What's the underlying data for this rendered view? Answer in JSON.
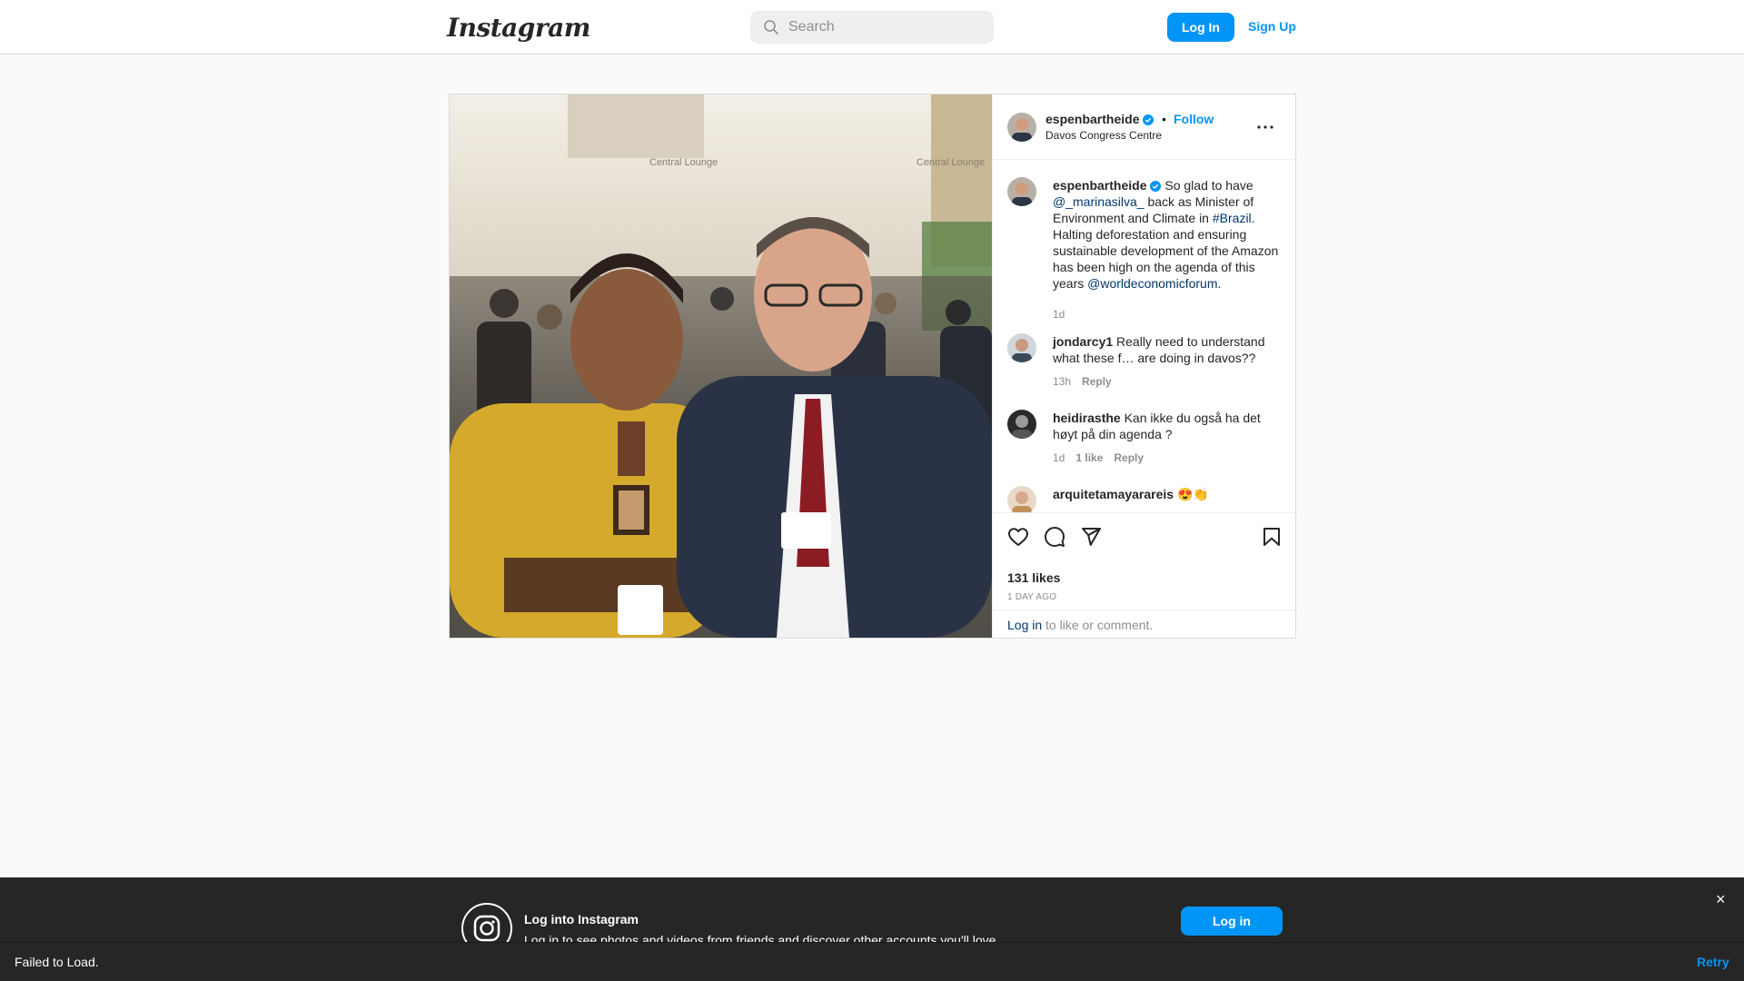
{
  "header": {
    "logo_text": "Instagram",
    "search_placeholder": "Search",
    "login_label": "Log In",
    "signup_label": "Sign Up"
  },
  "post": {
    "username": "espenbartheide",
    "separator": "•",
    "follow_label": "Follow",
    "location": "Davos Congress Centre",
    "caption": {
      "username": "espenbartheide",
      "text_1": " So glad to have ",
      "mention_1": "@_marinasilva_",
      "text_2": " back as Minister of Environment and Climate in ",
      "hashtag": "#Brazil",
      "text_3": ". Halting deforestation and ensuring sustainable development of the Amazon has been high on the agenda of this years ",
      "mention_2": "@worldeconomicforum",
      "text_4": ".",
      "time": "1d"
    },
    "comments": [
      {
        "username": "jondarcy1",
        "text": " Really need to understand what these f… are doing in davos??",
        "time": "13h",
        "likes": "",
        "reply": "Reply"
      },
      {
        "username": "heidirasthe",
        "text": " Kan ikke du også ha det høyt på din agenda ?",
        "time": "1d",
        "likes": "1 like",
        "reply": "Reply"
      },
      {
        "username": "arquitetamayarareis",
        "text": " 😍👏",
        "time": "",
        "likes": "",
        "reply": ""
      }
    ],
    "likes": "131 likes",
    "time_ago": "1 DAY AGO",
    "login_prompt_link": "Log in",
    "login_prompt_text": " to like or comment."
  },
  "banner": {
    "title": "Log into Instagram",
    "subtitle": "Log in to see photos and videos from friends and discover other accounts you'll love.",
    "login_label": "Log in",
    "close": "×"
  },
  "error_bar": {
    "message": "Failed to Load.",
    "retry_label": "Retry"
  },
  "colors": {
    "accent": "#0095f6",
    "link": "#00376b",
    "verified": "#0095f6"
  },
  "icons": [
    "search-icon",
    "verified-badge-icon",
    "more-options-icon",
    "heart-icon",
    "comment-icon",
    "share-icon",
    "bookmark-icon",
    "instagram-glyph-icon",
    "close-icon"
  ]
}
